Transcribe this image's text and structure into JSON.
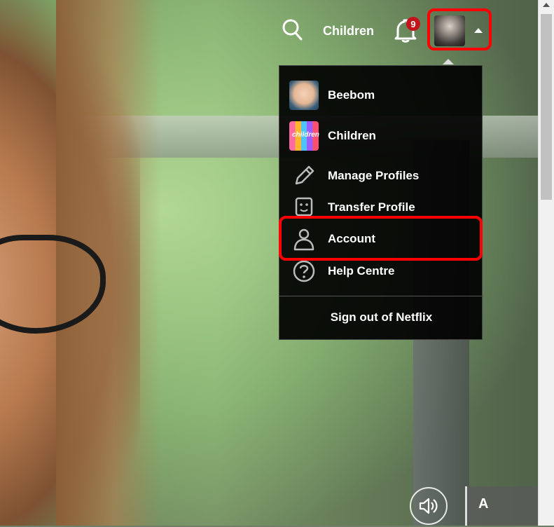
{
  "nav": {
    "profile_link": "Children",
    "notification_count": "9",
    "search_icon": "search-icon",
    "bell_icon": "bell-icon"
  },
  "menu": {
    "profiles": [
      {
        "label": "Beebom",
        "thumb": "Beebom"
      },
      {
        "label": "Children",
        "thumb": "children"
      }
    ],
    "actions": [
      {
        "label": "Manage Profiles",
        "icon": "pencil-icon"
      },
      {
        "label": "Transfer Profile",
        "icon": "transfer-profile-icon"
      },
      {
        "label": "Account",
        "icon": "person-icon"
      },
      {
        "label": "Help Centre",
        "icon": "help-icon"
      }
    ],
    "sign_out": "Sign out of Netflix"
  },
  "player": {
    "maturity_rating": "A",
    "volume_icon": "speaker-icon"
  },
  "colors": {
    "highlight": "#ff0000",
    "badge": "#c3131b",
    "menu_bg": "#000000"
  }
}
